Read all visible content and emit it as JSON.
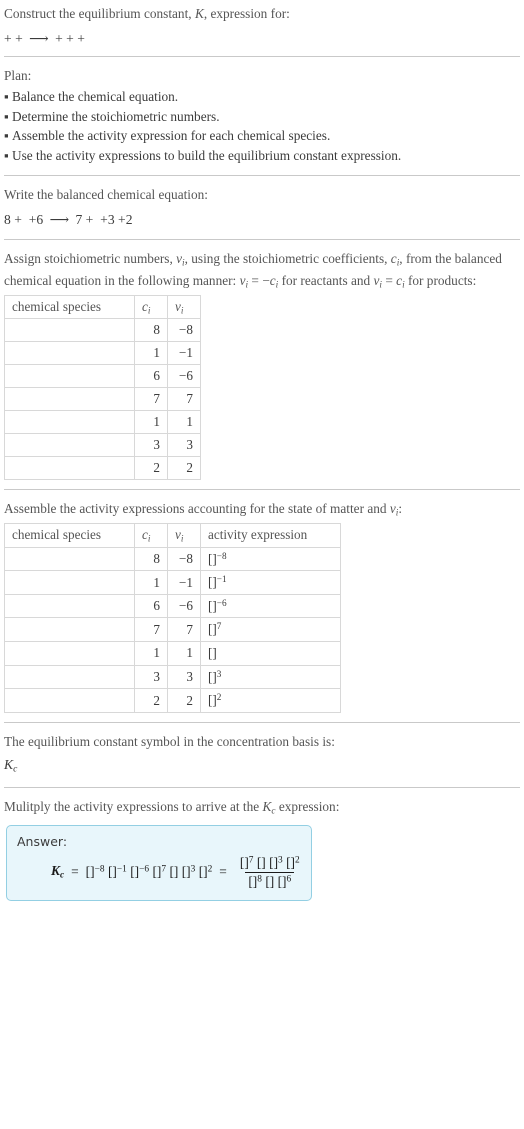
{
  "prompt": {
    "title_pre": "Construct the equilibrium constant, ",
    "title_sym": "K",
    "title_post": ", expression for:",
    "equation_terms": [
      "",
      "",
      ""
    ],
    "equation_products": [
      "",
      "",
      "",
      ""
    ],
    "arrow": "⟶",
    "plus": "+"
  },
  "plan": {
    "heading": "Plan:",
    "items": [
      "Balance the chemical equation.",
      "Determine the stoichiometric numbers.",
      "Assemble the activity expression for each chemical species.",
      "Use the activity expressions to build the equilibrium constant expression."
    ],
    "bullet": "▪"
  },
  "balanced": {
    "heading": "Write the balanced chemical equation:",
    "reactant_coeffs": [
      "8",
      "",
      "6"
    ],
    "product_coeffs": [
      "7",
      "",
      "3",
      "2"
    ]
  },
  "stoich": {
    "heading_1": "Assign stoichiometric numbers, ",
    "heading_nu": "ν",
    "heading_sub_i": "i",
    "heading_2": ", using the stoichiometric coefficients, ",
    "heading_c": "c",
    "heading_3": ", from the balanced chemical equation in the following manner: ",
    "heading_4": " = −",
    "heading_5": " for reactants and ",
    "heading_6": " = ",
    "heading_7": " for products:",
    "columns": [
      "chemical species",
      "c",
      "ν"
    ],
    "rows": [
      {
        "species": "",
        "c": "8",
        "nu": "−8"
      },
      {
        "species": "",
        "c": "1",
        "nu": "−1"
      },
      {
        "species": "",
        "c": "6",
        "nu": "−6"
      },
      {
        "species": "",
        "c": "7",
        "nu": "7"
      },
      {
        "species": "",
        "c": "1",
        "nu": "1"
      },
      {
        "species": "",
        "c": "3",
        "nu": "3"
      },
      {
        "species": "",
        "c": "2",
        "nu": "2"
      }
    ]
  },
  "activity": {
    "heading_1": "Assemble the activity expressions accounting for the state of matter and ",
    "heading_nu": "ν",
    "heading_sub_i": "i",
    "heading_2": ":",
    "columns": [
      "chemical species",
      "c",
      "ν",
      "activity expression"
    ],
    "rows": [
      {
        "species": "",
        "c": "8",
        "nu": "−8",
        "base": "[]",
        "exp": "−8"
      },
      {
        "species": "",
        "c": "1",
        "nu": "−1",
        "base": "[]",
        "exp": "−1"
      },
      {
        "species": "",
        "c": "6",
        "nu": "−6",
        "base": "[]",
        "exp": "−6"
      },
      {
        "species": "",
        "c": "7",
        "nu": "7",
        "base": "[]",
        "exp": "7"
      },
      {
        "species": "",
        "c": "1",
        "nu": "1",
        "base": "[]",
        "exp": ""
      },
      {
        "species": "",
        "c": "3",
        "nu": "3",
        "base": "[]",
        "exp": "3"
      },
      {
        "species": "",
        "c": "2",
        "nu": "2",
        "base": "[]",
        "exp": "2"
      }
    ]
  },
  "symbol": {
    "heading": "The equilibrium constant symbol in the concentration basis is:",
    "symbol_k": "K",
    "symbol_sub": "c"
  },
  "multiply": {
    "heading_1": "Mulitply the activity expressions to arrive at the ",
    "heading_k": "K",
    "heading_sub": "c",
    "heading_2": " expression:"
  },
  "answer": {
    "label": "Answer:",
    "kc_sym": "K",
    "kc_sub": "c",
    "equals": "=",
    "product_terms": [
      {
        "base": "[]",
        "exp": "−8"
      },
      {
        "base": "[]",
        "exp": "−1"
      },
      {
        "base": "[]",
        "exp": "−6"
      },
      {
        "base": "[]",
        "exp": "7"
      },
      {
        "base": "[]",
        "exp": ""
      },
      {
        "base": "[]",
        "exp": "3"
      },
      {
        "base": "[]",
        "exp": "2"
      }
    ],
    "numerator_terms": [
      {
        "base": "[]",
        "exp": "7"
      },
      {
        "base": "[]",
        "exp": ""
      },
      {
        "base": "[]",
        "exp": "3"
      },
      {
        "base": "[]",
        "exp": "2"
      }
    ],
    "denominator_terms": [
      {
        "base": "[]",
        "exp": "8"
      },
      {
        "base": "[]",
        "exp": ""
      },
      {
        "base": "[]",
        "exp": "6"
      }
    ]
  },
  "colors": {
    "rule": "#c9c9c9",
    "answer_bg": "#e8f6fb",
    "answer_border": "#93cfe3",
    "text": "#3b3b3b",
    "muted": "#555555",
    "table_border": "#d8d8d8"
  }
}
